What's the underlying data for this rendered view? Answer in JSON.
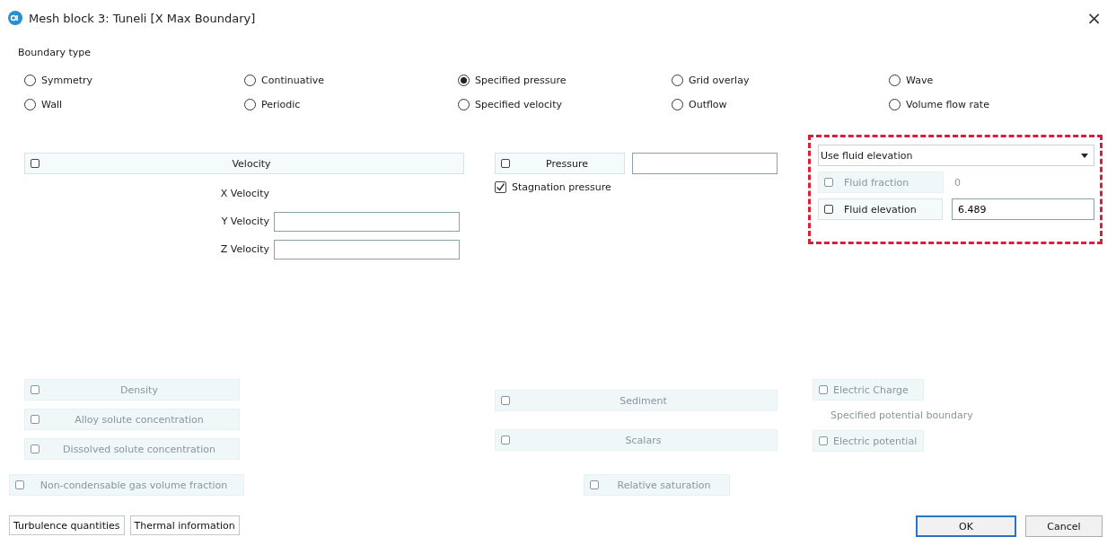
{
  "window": {
    "title": "Mesh block 3: Tuneli [X Max Boundary]",
    "close": "×"
  },
  "boundary_type": {
    "label": "Boundary type",
    "options": [
      {
        "label": "Symmetry",
        "selected": false
      },
      {
        "label": "Continuative",
        "selected": false
      },
      {
        "label": "Specified pressure",
        "selected": true
      },
      {
        "label": "Grid overlay",
        "selected": false
      },
      {
        "label": "Wave",
        "selected": false
      },
      {
        "label": "Wall",
        "selected": false
      },
      {
        "label": "Periodic",
        "selected": false
      },
      {
        "label": "Specified velocity",
        "selected": false
      },
      {
        "label": "Outflow",
        "selected": false
      },
      {
        "label": "Volume flow rate",
        "selected": false
      }
    ]
  },
  "velocity": {
    "toggle": {
      "label": "Velocity",
      "checked": false
    },
    "fields": [
      {
        "label": "X Velocity",
        "kind": "label"
      },
      {
        "label": "Y Velocity",
        "kind": "input"
      },
      {
        "label": "Z Velocity",
        "kind": "input"
      }
    ]
  },
  "pressure": {
    "toggle": {
      "label": "Pressure",
      "checked": false
    },
    "stagnation": {
      "label": "Stagnation pressure",
      "checked": true
    }
  },
  "fluid": {
    "highlighted": true,
    "dropdown": {
      "value": "Use fluid elevation"
    },
    "rows": [
      {
        "label": "Fluid fraction",
        "checked": false,
        "disabled": true,
        "value": "0",
        "kind": "text"
      },
      {
        "label": "Fluid elevation",
        "checked": false,
        "disabled": false,
        "value": "6.489",
        "kind": "input"
      }
    ]
  },
  "lower_left": [
    {
      "label": "Density",
      "checked": false,
      "disabled": true
    },
    {
      "label": "Alloy solute concentration",
      "checked": false,
      "disabled": true
    },
    {
      "label": "Dissolved solute concentration",
      "checked": false,
      "disabled": true
    }
  ],
  "lower_middle": [
    {
      "label": "Sediment",
      "checked": false,
      "disabled": true
    },
    {
      "label": "Scalars",
      "checked": false,
      "disabled": true
    }
  ],
  "electric": {
    "charge": {
      "label": "Electric Charge",
      "checked": false,
      "disabled": true
    },
    "note": "Specified potential boundary",
    "potential": {
      "label": "Electric potential",
      "checked": false,
      "disabled": true
    }
  },
  "bottom": [
    {
      "label": "Non-condensable gas volume fraction",
      "checked": false,
      "disabled": true
    },
    {
      "label": "Relative saturation",
      "checked": false,
      "disabled": true
    }
  ],
  "footer": {
    "left": [
      "Turbulence quantities",
      "Thermal information"
    ],
    "right": [
      {
        "label": "OK",
        "default": true
      },
      {
        "label": "Cancel",
        "default": false
      }
    ]
  }
}
